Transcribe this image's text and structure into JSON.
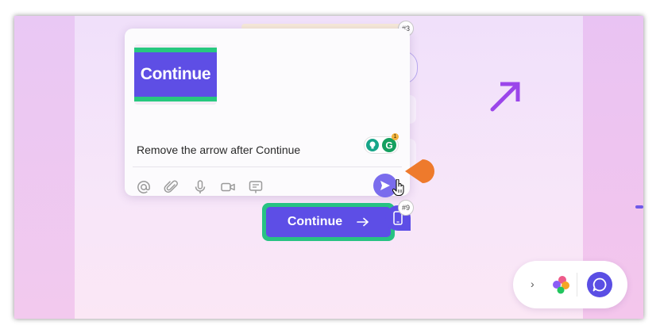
{
  "card": {
    "thumbnail_label": "Continue",
    "comment_text": "Remove the arrow after Continue",
    "grammarly_badge_count": "1"
  },
  "canvas": {
    "badge_top": "#3",
    "badge_continue": "#9",
    "continue_label": "Continue"
  },
  "icons": {
    "toolbar": [
      "at-icon",
      "paperclip-icon",
      "microphone-icon",
      "video-icon",
      "screen-share-icon"
    ],
    "send": "send-icon",
    "widget_chevron": "›"
  },
  "colors": {
    "accent_purple": "#5d4ee6",
    "send_purple": "#7a6ced",
    "green_border": "#27c283",
    "pin_orange": "#ee7a2c",
    "arrow_purple": "#9b45ea"
  }
}
